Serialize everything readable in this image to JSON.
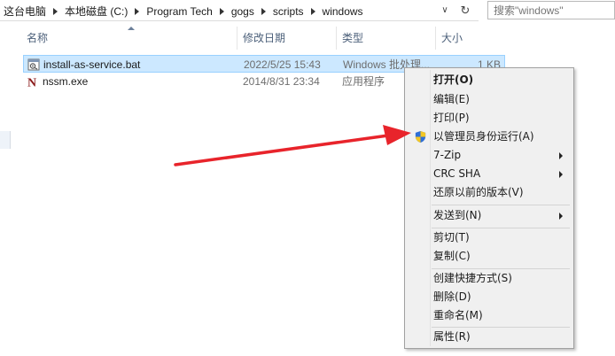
{
  "address": {
    "crumbs": [
      "这台电脑",
      "本地磁盘 (C:)",
      "Program Tech",
      "gogs",
      "scripts",
      "windows"
    ],
    "dropdown_icon": "chevron-down-icon",
    "refresh_icon": "refresh-icon"
  },
  "search": {
    "placeholder": "搜索\"windows\""
  },
  "columns": {
    "name": "名称",
    "date": "修改日期",
    "type": "类型",
    "size": "大小"
  },
  "files": [
    {
      "name": "install-as-service.bat",
      "date": "2022/5/25 15:43",
      "type": "Windows 批处理...",
      "size": "1 KB",
      "selected": true
    },
    {
      "name": "nssm.exe",
      "date": "2014/8/31 23:34",
      "type": "应用程序",
      "size": "",
      "selected": false
    }
  ],
  "context_menu": {
    "open": "打开(O)",
    "edit": "编辑(E)",
    "print": "打印(P)",
    "run_as_admin": "以管理员身份运行(A)",
    "seven_zip": "7-Zip",
    "crc_sha": "CRC SHA",
    "restore_prev": "还原以前的版本(V)",
    "send_to": "发送到(N)",
    "cut": "剪切(T)",
    "copy": "复制(C)",
    "create_shortcut": "创建快捷方式(S)",
    "delete": "删除(D)",
    "rename": "重命名(M)",
    "properties": "属性(R)"
  },
  "colors": {
    "selection": "#cce8ff",
    "arrow": "#e8242b",
    "menu_bg": "#f0f0f0"
  }
}
